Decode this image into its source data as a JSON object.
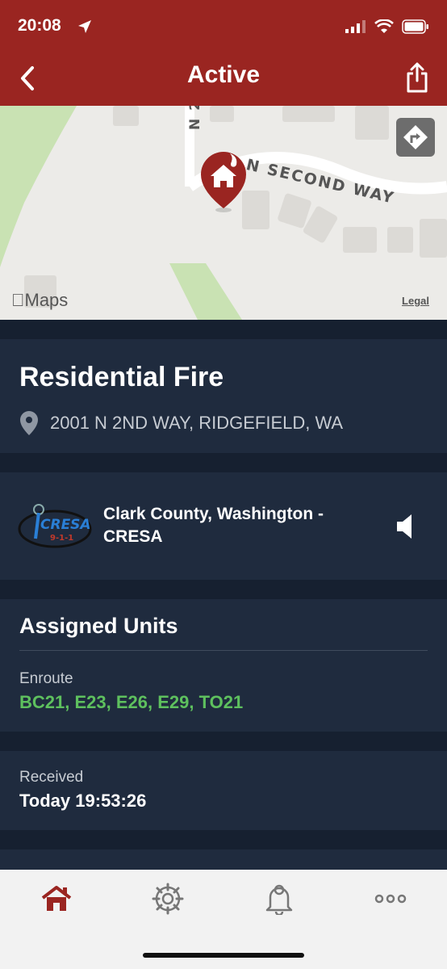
{
  "status_bar": {
    "time": "20:08"
  },
  "nav": {
    "title": "Active"
  },
  "map": {
    "street_label": "N SECOND WAY",
    "street_label_vertical": "N 2",
    "maps_brand": "Maps",
    "legal": "Legal"
  },
  "incident": {
    "title": "Residential Fire",
    "address": "2001 N 2ND WAY, RIDGEFIELD, WA"
  },
  "agency": {
    "name": "Clark County, Washington - CRESA",
    "logo_text": "CRESA",
    "logo_sub": "9-1-1"
  },
  "units": {
    "title": "Assigned Units",
    "status_label": "Enroute",
    "list": "BC21, E23, E26, E29, TO21"
  },
  "received": {
    "label": "Received",
    "value": "Today 19:53:26"
  },
  "colors": {
    "header": "#9a2521",
    "background": "#1a2433",
    "card": "#1f2b3e",
    "enroute": "#5ec05e"
  },
  "tabbar": {
    "icons": [
      "home-icon",
      "fire-badge-icon",
      "alert-settings-icon",
      "more-icon"
    ]
  }
}
